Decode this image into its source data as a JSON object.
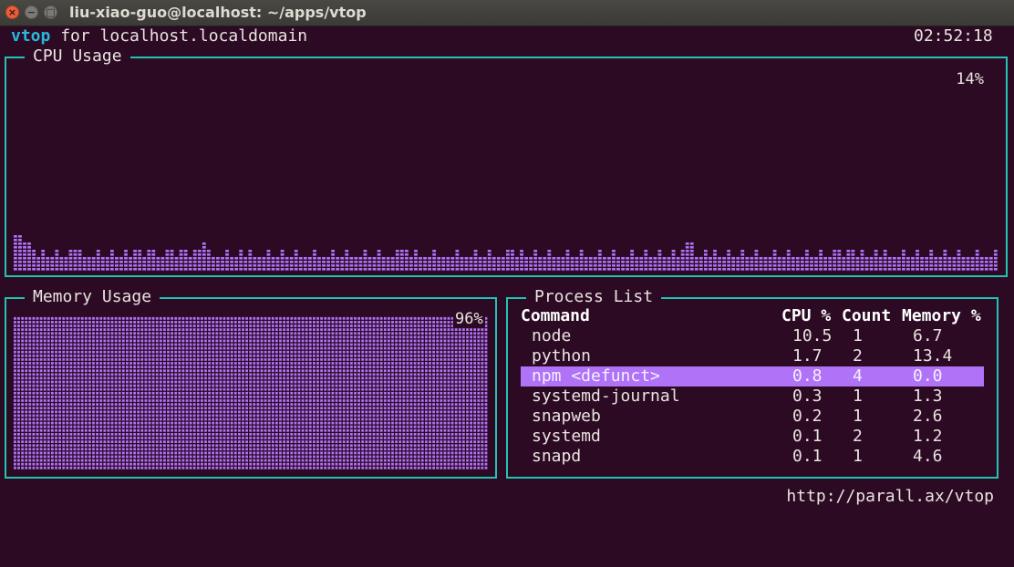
{
  "window": {
    "title": "liu-xiao-guo@localhost: ~/apps/vtop",
    "close_glyph": "×",
    "minimize_glyph": "−",
    "maximize_glyph": "□"
  },
  "header": {
    "app_name": "vtop",
    "host_text": " for localhost.localdomain",
    "clock": "02:52:18"
  },
  "cpu": {
    "label": "CPU Usage",
    "current_percent": "14%",
    "history_levels": [
      4,
      4,
      3,
      3,
      2,
      1,
      2,
      1,
      1,
      2,
      1,
      1,
      2,
      2,
      2,
      1,
      1,
      1,
      2,
      1,
      1,
      2,
      1,
      1,
      2,
      1,
      2,
      2,
      1,
      2,
      2,
      1,
      1,
      2,
      2,
      1,
      2,
      2,
      1,
      2,
      2,
      3,
      2,
      1,
      1,
      1,
      2,
      1,
      1,
      2,
      1,
      2,
      1,
      1,
      1,
      2,
      1,
      1,
      2,
      1,
      1,
      2,
      1,
      1,
      1,
      2,
      1,
      1,
      1,
      2,
      1,
      1,
      2,
      1,
      1,
      1,
      2,
      1,
      1,
      2,
      1,
      1,
      1,
      2,
      2,
      2,
      1,
      2,
      1,
      1,
      1,
      2,
      1,
      1,
      1,
      1,
      2,
      1,
      1,
      1,
      2,
      1,
      1,
      2,
      1,
      1,
      1,
      2,
      2,
      1,
      2,
      1,
      1,
      2,
      1,
      1,
      2,
      1,
      1,
      1,
      2,
      1,
      1,
      2,
      1,
      1,
      1,
      2,
      1,
      1,
      2,
      1,
      1,
      1,
      2,
      1,
      1,
      2,
      1,
      1,
      2,
      1,
      1,
      2,
      1,
      2,
      3,
      3,
      1,
      1,
      2,
      1,
      2,
      1,
      1,
      2,
      1,
      1,
      2,
      1,
      1,
      2,
      1,
      1,
      1,
      2,
      1,
      1,
      2,
      1,
      1,
      1,
      2,
      1,
      1,
      2,
      1,
      1,
      2,
      2,
      1,
      2,
      2,
      1,
      2,
      1,
      1,
      2,
      1,
      2,
      1,
      1,
      1,
      2,
      1,
      1,
      2,
      1,
      1,
      2,
      1,
      1,
      2,
      1,
      1,
      2,
      1,
      1,
      1,
      2,
      1,
      1,
      1,
      2
    ]
  },
  "memory": {
    "label": "Memory Usage",
    "percent": "96%",
    "fill_fraction": 0.96
  },
  "processes": {
    "label": "Process List",
    "columns": {
      "command": "Command",
      "cpu": "CPU %",
      "count": "Count",
      "memory": "Memory %"
    },
    "rows": [
      {
        "command": "node",
        "cpu": "10.5",
        "count": "1",
        "memory": "6.7"
      },
      {
        "command": "python",
        "cpu": "1.7",
        "count": "2",
        "memory": "13.4"
      },
      {
        "command": "npm <defunct>",
        "cpu": "0.8",
        "count": "4",
        "memory": "0.0"
      },
      {
        "command": "systemd-journal",
        "cpu": "0.3",
        "count": "1",
        "memory": "1.3"
      },
      {
        "command": "snapweb",
        "cpu": "0.2",
        "count": "1",
        "memory": "2.6"
      },
      {
        "command": "systemd",
        "cpu": "0.1",
        "count": "2",
        "memory": "1.2"
      },
      {
        "command": "snapd",
        "cpu": "0.1",
        "count": "1",
        "memory": "4.6"
      }
    ],
    "selected_index": 2
  },
  "footer": {
    "url": "http://parall.ax/vtop"
  },
  "colors": {
    "background": "#2c0a23",
    "border": "#23c3b3",
    "chart_fill": "#b073f7",
    "brand": "#29b8db",
    "selection": "#b073f7"
  }
}
